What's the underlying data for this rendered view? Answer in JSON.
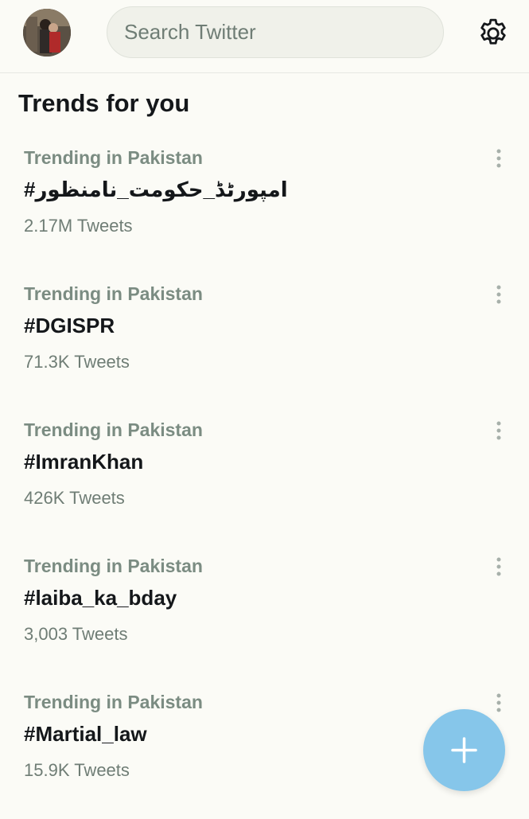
{
  "header": {
    "search_placeholder": "Search Twitter",
    "avatar_icon": "user-avatar",
    "settings_icon": "gear-icon"
  },
  "section": {
    "title": "Trends for you"
  },
  "trends": [
    {
      "context": "Trending in Pakistan",
      "name": "#امپورٹڈ_حکومت_نامنظور",
      "count": "2.17M Tweets"
    },
    {
      "context": "Trending in Pakistan",
      "name": "#DGISPR",
      "count": "71.3K Tweets"
    },
    {
      "context": "Trending in Pakistan",
      "name": "#ImranKhan",
      "count": "426K Tweets"
    },
    {
      "context": "Trending in Pakistan",
      "name": "#laiba_ka_bday",
      "count": "3,003 Tweets"
    },
    {
      "context": "Trending in Pakistan",
      "name": "#Martial_law",
      "count": "15.9K Tweets"
    }
  ],
  "fab": {
    "icon": "plus-icon",
    "color": "#86c6ea"
  },
  "colors": {
    "background": "#fbfbf6",
    "accent": "#86c6ea",
    "muted_text": "#7b8c82"
  }
}
